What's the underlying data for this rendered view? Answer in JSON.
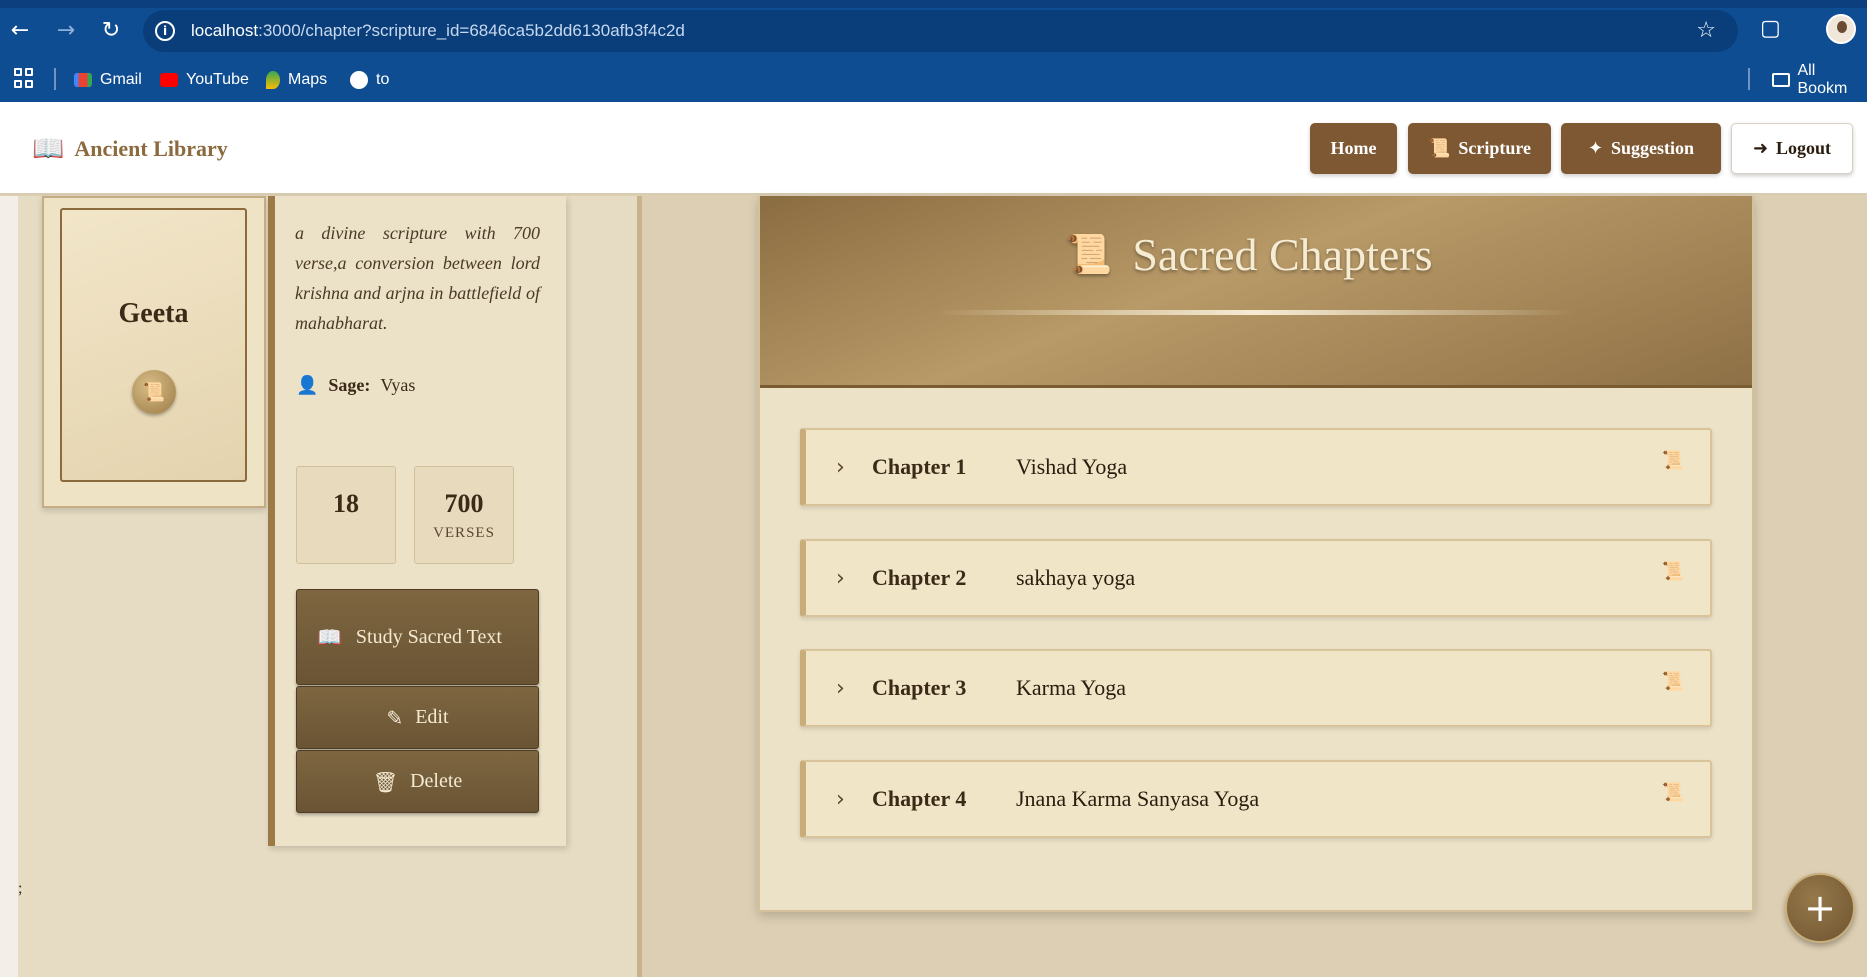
{
  "browser": {
    "url_host": "localhost",
    "url_rest": ":3000/chapter?scripture_id=6846ca5b2dd6130afb3f4c2d",
    "bookmarks": [
      "Gmail",
      "YouTube",
      "Maps",
      "to"
    ],
    "all_bookmarks": "All Bookm"
  },
  "header": {
    "brand": "Ancient Library",
    "nav": {
      "home": "Home",
      "scripture": "Scripture",
      "suggestion": "Suggestion",
      "logout": "Logout"
    }
  },
  "scripture": {
    "title": "Geeta",
    "description": "a divine scripture with 700 verse,a conversion between lord krishna and arjna in battlefield of mahabharat.",
    "sage_label": "Sage:",
    "sage_name": "Vyas",
    "stats": [
      {
        "value": "18",
        "label": ""
      },
      {
        "value": "700",
        "label": "VERSES"
      }
    ],
    "actions": {
      "study": "Study Sacred Text",
      "edit": "Edit",
      "delete": "Delete"
    }
  },
  "stray_text": ";",
  "chapters": {
    "heading": "Sacred Chapters",
    "items": [
      {
        "number": "Chapter 1",
        "name": "Vishad Yoga"
      },
      {
        "number": "Chapter 2",
        "name": "sakhaya yoga"
      },
      {
        "number": "Chapter 3",
        "name": "Karma Yoga"
      },
      {
        "number": "Chapter 4",
        "name": "Jnana Karma Sanyasa Yoga"
      }
    ]
  },
  "fab_label": "+",
  "colors": {
    "primary_brown": "#7d5832",
    "parchment": "#ece2c8",
    "browser_blue": "#0f4d92"
  }
}
